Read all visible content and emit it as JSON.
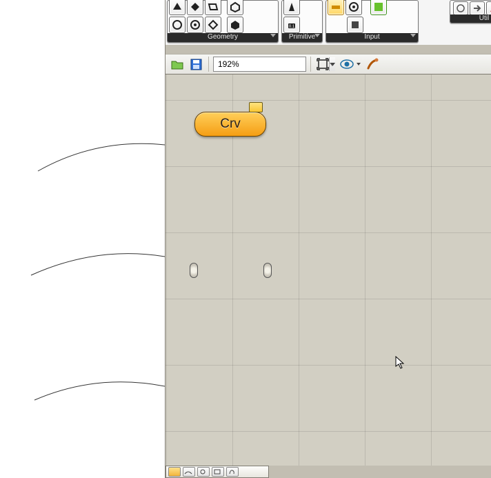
{
  "ribbon": {
    "groups": [
      {
        "id": "geometry",
        "label": "Geometry"
      },
      {
        "id": "primitive",
        "label": "Primitive"
      },
      {
        "id": "input",
        "label": "Input"
      },
      {
        "id": "util",
        "label": "Util"
      }
    ]
  },
  "toolbar": {
    "zoom_value": "192%"
  },
  "canvas": {
    "nodes": [
      {
        "id": "crv-param",
        "label": "Crv"
      }
    ]
  },
  "icons": {
    "open": "open-icon",
    "save": "save-icon",
    "zoom_fit": "zoom-fit-icon",
    "preview": "preview-eye-icon",
    "sketch": "sketch-brush-icon"
  }
}
